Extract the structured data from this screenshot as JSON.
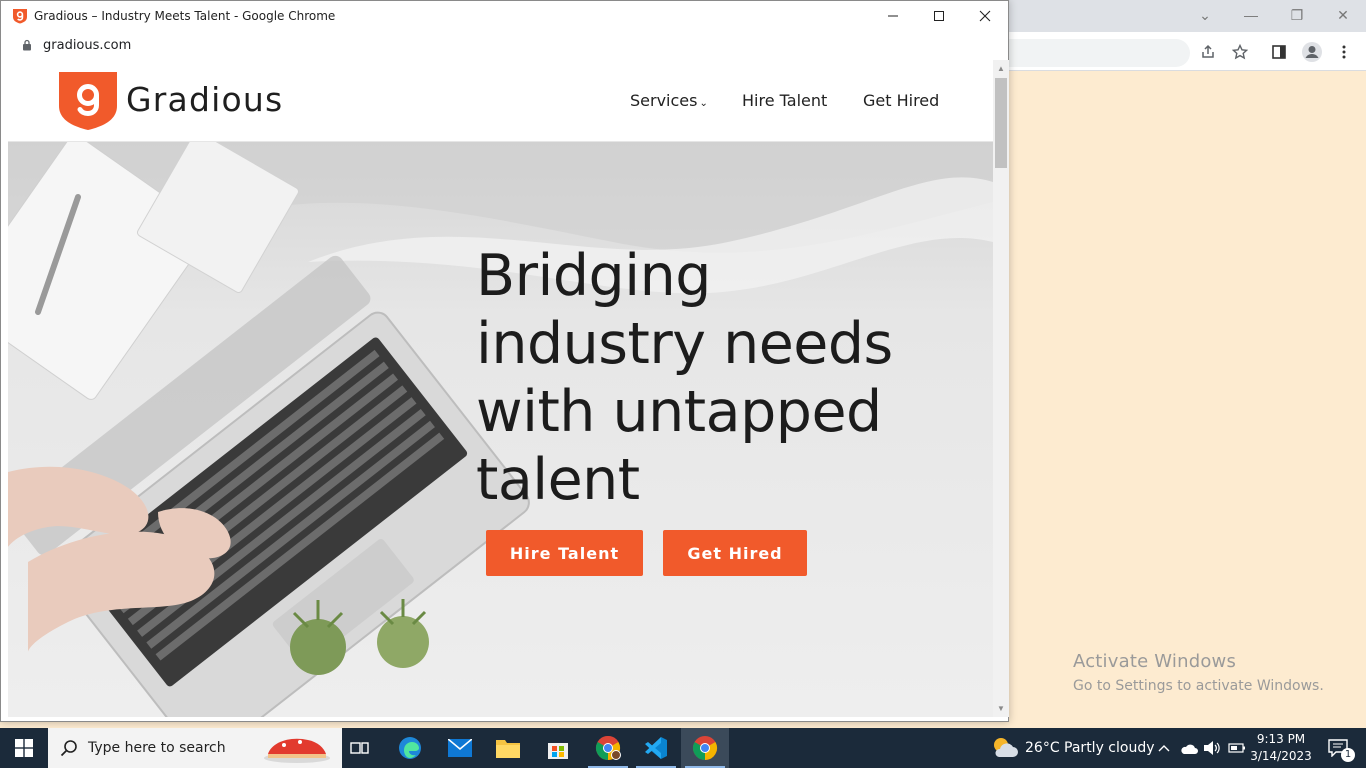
{
  "window": {
    "title": "Gradious – Industry Meets Talent - Google Chrome",
    "url": "gradious.com"
  },
  "site": {
    "brand": "Gradious",
    "nav": {
      "services": "Services",
      "hire_talent": "Hire Talent",
      "get_hired": "Get Hired"
    },
    "hero": {
      "headline": "Bridging industry needs with untapped talent",
      "cta_hire": "Hire Talent",
      "cta_get_hired": "Get Hired"
    }
  },
  "watermark": {
    "line1": "Activate Windows",
    "line2": "Go to Settings to activate Windows."
  },
  "taskbar": {
    "search_placeholder": "Type here to search",
    "weather": "26°C  Partly cloudy",
    "time": "9:13 PM",
    "date": "3/14/2023",
    "notification_count": "1"
  },
  "colors": {
    "accent": "#f15a2b",
    "taskbar": "#1b2a3a",
    "desktop_bg": "#fdebd0"
  }
}
